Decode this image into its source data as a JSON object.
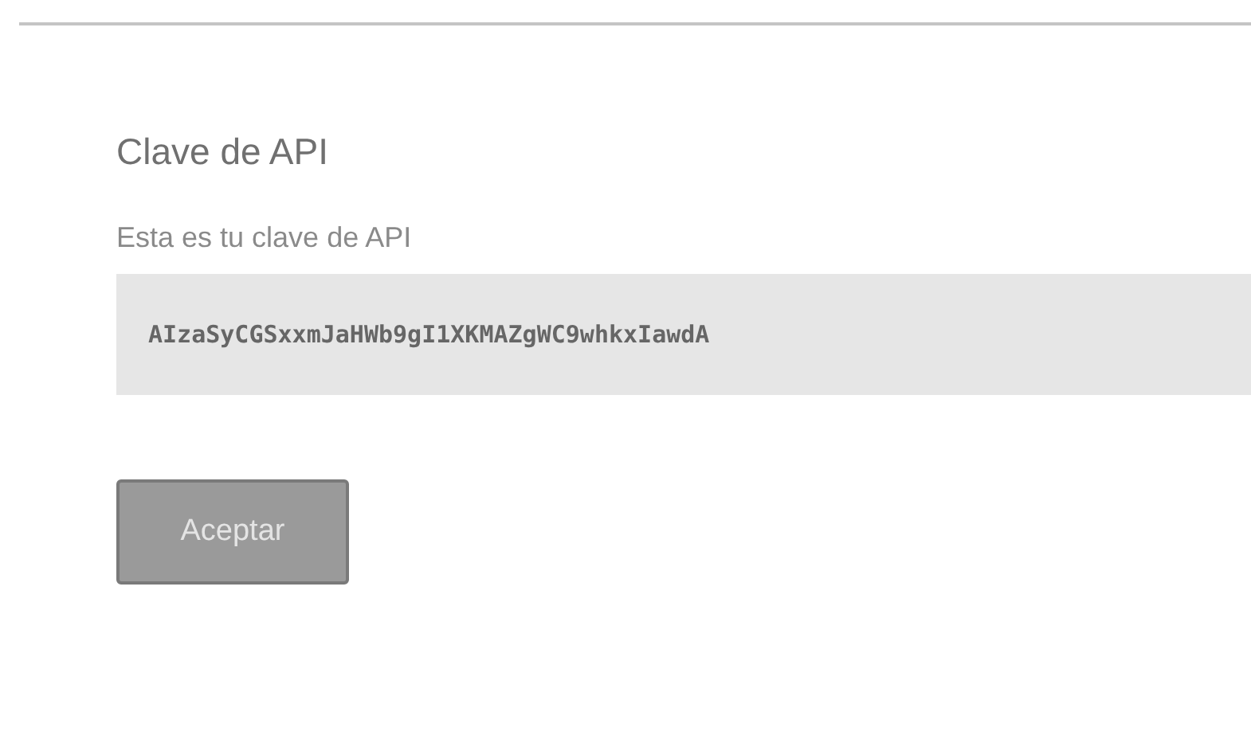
{
  "dialog": {
    "title": "Clave de API",
    "label": "Esta es tu clave de API",
    "api_key": "AIzaSyCGSxxmJaHWb9gI1XKMAZgWC9whkxIawdA",
    "button": "Aceptar"
  }
}
